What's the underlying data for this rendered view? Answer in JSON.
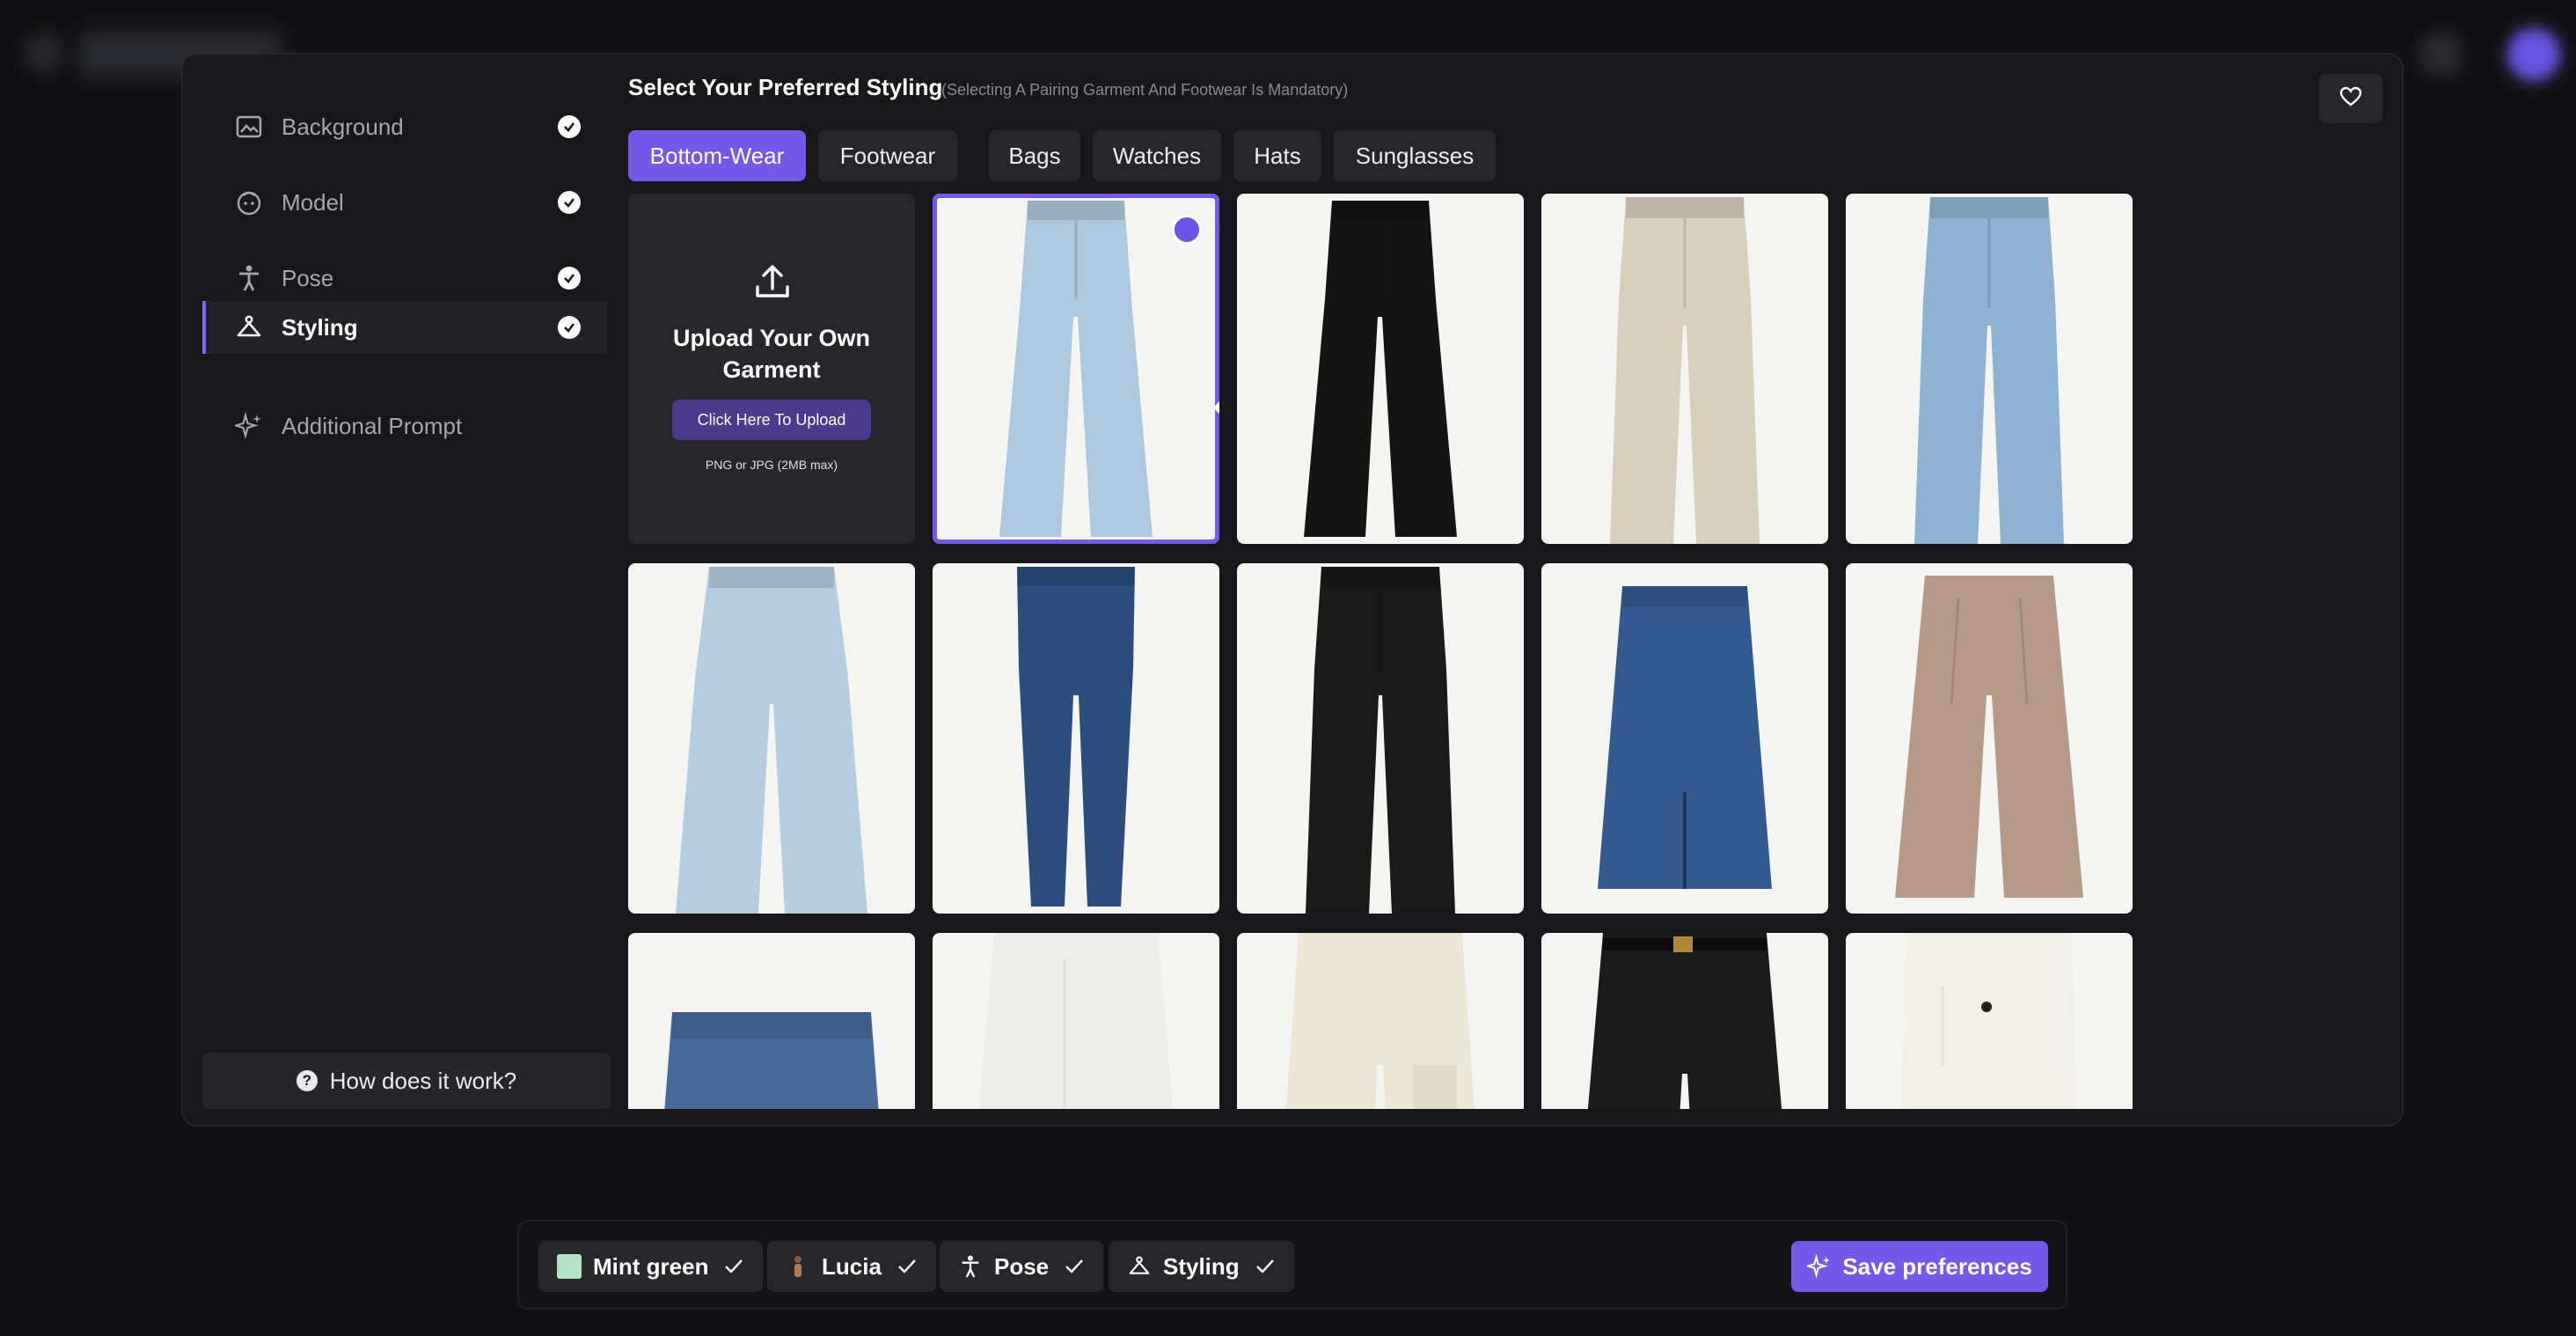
{
  "sidebar": {
    "items": [
      {
        "label": "Background",
        "icon": "image-icon",
        "done": true
      },
      {
        "label": "Model",
        "icon": "face-icon",
        "done": true
      },
      {
        "label": "Pose",
        "icon": "person-pose-icon",
        "done": true
      },
      {
        "label": "Styling",
        "icon": "hanger-icon",
        "done": true,
        "active": true
      },
      {
        "label": "Additional Prompt",
        "icon": "sparkles-icon",
        "done": false
      }
    ],
    "help_label": "How does it work?"
  },
  "header": {
    "title": "Select Your Preferred Styling",
    "subtitle": "(Selecting A Pairing Garment And Footwear Is Mandatory)"
  },
  "tabs": [
    {
      "label": "Bottom-Wear",
      "active": true
    },
    {
      "label": "Footwear",
      "active": false
    },
    {
      "label": "Bags",
      "active": false
    },
    {
      "label": "Watches",
      "active": false
    },
    {
      "label": "Hats",
      "active": false
    },
    {
      "label": "Sunglasses",
      "active": false
    }
  ],
  "upload": {
    "title_line1": "Upload Your Own",
    "title_line2": "Garment",
    "button_label": "Click Here To Upload",
    "note": "PNG or JPG (2MB max)"
  },
  "garments": [
    {
      "kind": "flare-jeans",
      "color": "#aec8dd",
      "selected": true
    },
    {
      "kind": "flare-pants",
      "color": "#141414",
      "selected": false
    },
    {
      "kind": "straight-pants",
      "color": "#d9d0bc",
      "selected": false
    },
    {
      "kind": "straight-jeans",
      "color": "#8fb2d0",
      "selected": false
    },
    {
      "kind": "wide-jeans",
      "color": "#b4cde0",
      "selected": false
    },
    {
      "kind": "skinny-jeans",
      "color": "#2c4d7c",
      "selected": false
    },
    {
      "kind": "straight-pants",
      "color": "#1a1a1a",
      "selected": false
    },
    {
      "kind": "denim-skirt",
      "color": "#34598e",
      "selected": false
    },
    {
      "kind": "pleated-trousers",
      "color": "#b59a87",
      "selected": false
    },
    {
      "kind": "denim-shorts",
      "color": "#46699a",
      "selected": false
    },
    {
      "kind": "white-skirt",
      "color": "#ececea",
      "selected": false
    },
    {
      "kind": "cargo-pants",
      "color": "#ece6d6",
      "selected": false
    },
    {
      "kind": "belted-trousers",
      "color": "#1b1b1b",
      "selected": false
    },
    {
      "kind": "white-trousers",
      "color": "#f1efe9",
      "selected": false
    }
  ],
  "summary_chips": [
    {
      "label": "Mint green",
      "icon": "swatch-icon",
      "swatch": "#b8e2c8"
    },
    {
      "label": "Lucia",
      "icon": "model-thumb-icon"
    },
    {
      "label": "Pose",
      "icon": "person-pose-icon"
    },
    {
      "label": "Styling",
      "icon": "hanger-icon"
    }
  ],
  "save_label": "Save preferences",
  "colors": {
    "accent": "#7458e8",
    "panel": "#18181b",
    "surface": "#26262b"
  }
}
